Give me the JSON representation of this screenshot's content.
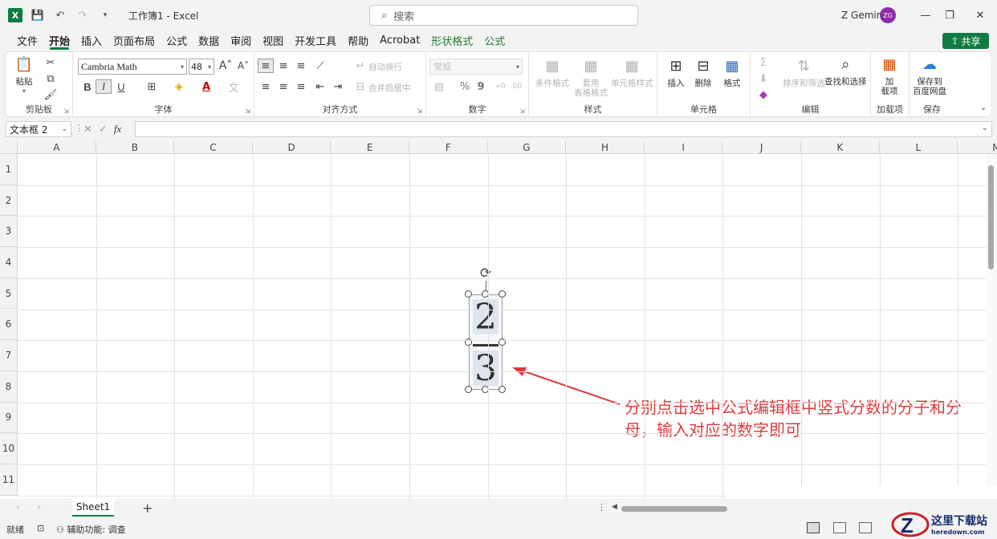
{
  "titlebar": {
    "doc_title": "工作簿1  -  Excel",
    "search_placeholder": "搜索",
    "user_name": "Z Gemini",
    "user_initials": "ZG"
  },
  "tabs": [
    {
      "label": "文件",
      "style": "normal"
    },
    {
      "label": "开始",
      "style": "active"
    },
    {
      "label": "插入",
      "style": "normal"
    },
    {
      "label": "页面布局",
      "style": "normal"
    },
    {
      "label": "公式",
      "style": "normal"
    },
    {
      "label": "数据",
      "style": "normal"
    },
    {
      "label": "审阅",
      "style": "normal"
    },
    {
      "label": "视图",
      "style": "normal"
    },
    {
      "label": "开发工具",
      "style": "normal"
    },
    {
      "label": "帮助",
      "style": "normal"
    },
    {
      "label": "Acrobat",
      "style": "normal"
    },
    {
      "label": "形状格式",
      "style": "green"
    },
    {
      "label": "公式",
      "style": "green"
    }
  ],
  "share_label": "共享",
  "ribbon": {
    "clipboard": {
      "group_label": "剪贴板",
      "paste": "粘贴"
    },
    "font": {
      "group_label": "字体",
      "font_name": "Cambria Math",
      "font_size": "48",
      "bold": "B",
      "italic": "I",
      "underline": "U",
      "grow": "A",
      "shrink": "A"
    },
    "alignment": {
      "group_label": "对齐方式",
      "wrap_text": "自动换行",
      "merge_center": "合并后居中"
    },
    "number": {
      "group_label": "数字",
      "format": "常规",
      "percent": "%",
      "comma": "9"
    },
    "styles": {
      "group_label": "样式",
      "conditional": "条件格式",
      "table_line1": "套用",
      "table_line2": "表格格式",
      "cell_styles": "单元格样式"
    },
    "cells": {
      "group_label": "单元格",
      "insert": "插入",
      "delete": "删除",
      "format": "格式"
    },
    "editing": {
      "group_label": "编辑",
      "sort_filter": "排序和筛选",
      "find_select": "查找和选择"
    },
    "addins": {
      "group_label": "加载项",
      "line1": "加",
      "line2": "载项"
    },
    "save": {
      "group_label": "保存",
      "line1": "保存到",
      "line2": "百度网盘"
    }
  },
  "formula_bar": {
    "name_box": "文本框 2",
    "fx": "fx"
  },
  "columns": [
    "A",
    "B",
    "C",
    "D",
    "E",
    "F",
    "G",
    "H",
    "I",
    "J",
    "K",
    "L",
    "M"
  ],
  "rows": [
    "1",
    "2",
    "3",
    "4",
    "5",
    "6",
    "7",
    "8",
    "9",
    "10",
    "11"
  ],
  "fraction": {
    "numerator": "2",
    "denominator": "3"
  },
  "annotation": "分别点击选中公式编辑框中竖式分数的分子和分母，输入对应的数字即可",
  "colors": {
    "annotation": "#e0393b",
    "accent": "#107c41"
  },
  "sheet": {
    "tab_label": "Sheet1",
    "add": "+"
  },
  "status": {
    "ready": "就绪",
    "accessibility": "辅助功能: 调查"
  },
  "watermark": {
    "cn": "这里下载站",
    "en": "heredown.com"
  }
}
